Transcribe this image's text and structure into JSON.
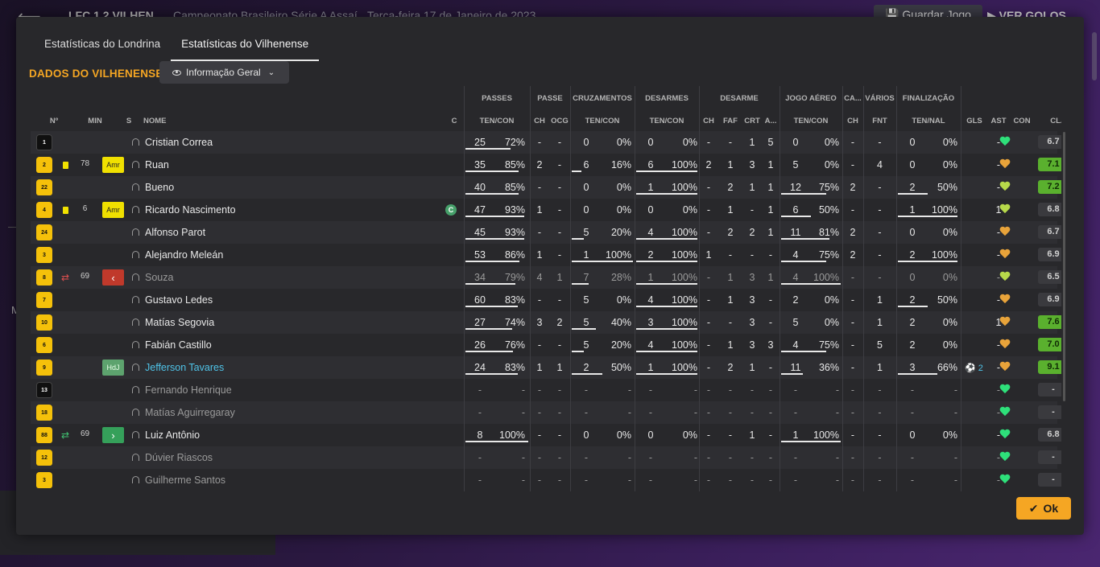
{
  "background": {
    "score": "LFC  1  2  VILHEN",
    "competition": "Campeonato Brasileiro Série A Assaí",
    "date": "Terça-feira 17 de Janeiro de 2023",
    "save_label": "Guardar Jogo",
    "goals_label": "VER GOLOS",
    "side_letter": "M"
  },
  "tabs": [
    {
      "label": "Estatísticas do Londrina"
    },
    {
      "label": "Estatísticas do Vilhenense"
    }
  ],
  "section_title": "DADOS DO VILHENENSE",
  "dropdown_label": "Informação Geral",
  "group_headers": [
    "PASSES",
    "PASSE",
    "CRUZAMENTOS",
    "DESARMES",
    "DESARME",
    "JOGO AÉREO",
    "CA...",
    "VÁRIOS",
    "FINALIZAÇÃO"
  ],
  "col_headers": [
    "Nº",
    "MIN",
    "S",
    "NOME",
    "C",
    "TEN/CON",
    "CH",
    "OCG",
    "TEN/CON",
    "TEN/CON",
    "CH",
    "FAF",
    "CRT",
    "A...",
    "TEN/CON",
    "CH",
    "FNT",
    "TEN/NAL",
    "GLS",
    "AST",
    "CON",
    "CLA"
  ],
  "players": [
    {
      "num": "1",
      "kit": "b",
      "card": "",
      "swap": "",
      "min": "",
      "badge": "",
      "badge_text": "",
      "name": "Cristian Correa",
      "cap": "",
      "dim": false,
      "link": false,
      "passes": [
        "25",
        "72%"
      ],
      "passes_pct": 72,
      "pch": "-",
      "ocg": "-",
      "cross": [
        "0",
        "0%"
      ],
      "cross_pct": 0,
      "tack": [
        "0",
        "0%"
      ],
      "tack_pct": 0,
      "dch": "-",
      "faf": "-",
      "crt": "1",
      "a": "5",
      "aer": [
        "0",
        "0%"
      ],
      "aer_pct": 0,
      "cach": "-",
      "fnt": "-",
      "fin": [
        "0",
        "0%"
      ],
      "fin_pct": 0,
      "gls": "",
      "ast": "-",
      "heart": "green",
      "rating": "6.7",
      "rating_good": false
    },
    {
      "num": "2",
      "kit": "y",
      "card": "yellow",
      "swap": "",
      "min": "78",
      "badge": "amr",
      "badge_text": "Amr",
      "name": "Ruan",
      "cap": "",
      "dim": false,
      "link": false,
      "passes": [
        "35",
        "85%"
      ],
      "passes_pct": 85,
      "pch": "2",
      "ocg": "-",
      "cross": [
        "6",
        "16%"
      ],
      "cross_pct": 16,
      "tack": [
        "6",
        "100%"
      ],
      "tack_pct": 100,
      "dch": "2",
      "faf": "1",
      "crt": "3",
      "a": "1",
      "aer": [
        "5",
        "0%"
      ],
      "aer_pct": 0,
      "cach": "-",
      "fnt": "4",
      "fin": [
        "0",
        "0%"
      ],
      "fin_pct": 0,
      "gls": "",
      "ast": "-",
      "heart": "orange",
      "rating": "7.1",
      "rating_good": true
    },
    {
      "num": "22",
      "kit": "y",
      "card": "",
      "swap": "",
      "min": "",
      "badge": "",
      "badge_text": "",
      "name": "Bueno",
      "cap": "",
      "dim": false,
      "link": false,
      "passes": [
        "40",
        "85%"
      ],
      "passes_pct": 85,
      "pch": "-",
      "ocg": "-",
      "cross": [
        "0",
        "0%"
      ],
      "cross_pct": 0,
      "tack": [
        "1",
        "100%"
      ],
      "tack_pct": 100,
      "dch": "-",
      "faf": "2",
      "crt": "1",
      "a": "1",
      "aer": [
        "12",
        "75%"
      ],
      "aer_pct": 75,
      "cach": "2",
      "fnt": "-",
      "fin": [
        "2",
        "50%"
      ],
      "fin_pct": 50,
      "gls": "",
      "ast": "-",
      "heart": "lime",
      "rating": "7.2",
      "rating_good": true
    },
    {
      "num": "4",
      "kit": "y",
      "card": "yellow",
      "swap": "",
      "min": "6",
      "badge": "amr",
      "badge_text": "Amr",
      "name": "Ricardo Nascimento",
      "cap": "C",
      "dim": false,
      "link": false,
      "passes": [
        "47",
        "93%"
      ],
      "passes_pct": 93,
      "pch": "1",
      "ocg": "-",
      "cross": [
        "0",
        "0%"
      ],
      "cross_pct": 0,
      "tack": [
        "0",
        "0%"
      ],
      "tack_pct": 0,
      "dch": "-",
      "faf": "1",
      "crt": "-",
      "a": "1",
      "aer": [
        "6",
        "50%"
      ],
      "aer_pct": 50,
      "cach": "-",
      "fnt": "-",
      "fin": [
        "1",
        "100%"
      ],
      "fin_pct": 100,
      "gls": "",
      "ast": "1",
      "heart": "lime",
      "rating": "6.8",
      "rating_good": false
    },
    {
      "num": "24",
      "kit": "y",
      "card": "",
      "swap": "",
      "min": "",
      "badge": "",
      "badge_text": "",
      "name": "Alfonso Parot",
      "cap": "",
      "dim": false,
      "link": false,
      "passes": [
        "45",
        "93%"
      ],
      "passes_pct": 93,
      "pch": "-",
      "ocg": "-",
      "cross": [
        "5",
        "20%"
      ],
      "cross_pct": 20,
      "tack": [
        "4",
        "100%"
      ],
      "tack_pct": 100,
      "dch": "-",
      "faf": "2",
      "crt": "2",
      "a": "1",
      "aer": [
        "11",
        "81%"
      ],
      "aer_pct": 81,
      "cach": "2",
      "fnt": "-",
      "fin": [
        "0",
        "0%"
      ],
      "fin_pct": 0,
      "gls": "",
      "ast": "-",
      "heart": "orange",
      "rating": "6.7",
      "rating_good": false
    },
    {
      "num": "3",
      "kit": "y",
      "card": "",
      "swap": "",
      "min": "",
      "badge": "",
      "badge_text": "",
      "name": "Alejandro Meleán",
      "cap": "",
      "dim": false,
      "link": false,
      "passes": [
        "53",
        "86%"
      ],
      "passes_pct": 86,
      "pch": "1",
      "ocg": "-",
      "cross": [
        "1",
        "100%"
      ],
      "cross_pct": 100,
      "tack": [
        "2",
        "100%"
      ],
      "tack_pct": 100,
      "dch": "1",
      "faf": "-",
      "crt": "-",
      "a": "-",
      "aer": [
        "4",
        "75%"
      ],
      "aer_pct": 75,
      "cach": "2",
      "fnt": "-",
      "fin": [
        "2",
        "100%"
      ],
      "fin_pct": 100,
      "gls": "",
      "ast": "-",
      "heart": "orange",
      "rating": "6.9",
      "rating_good": false
    },
    {
      "num": "8",
      "kit": "y",
      "card": "",
      "swap": "out",
      "min": "69",
      "badge": "out",
      "badge_text": "‹",
      "name": "Souza",
      "cap": "",
      "dim": true,
      "link": false,
      "passes": [
        "34",
        "79%"
      ],
      "passes_pct": 79,
      "pch": "4",
      "ocg": "1",
      "cross": [
        "7",
        "28%"
      ],
      "cross_pct": 28,
      "tack": [
        "1",
        "100%"
      ],
      "tack_pct": 100,
      "dch": "-",
      "faf": "1",
      "crt": "3",
      "a": "1",
      "aer": [
        "4",
        "100%"
      ],
      "aer_pct": 100,
      "cach": "-",
      "fnt": "-",
      "fin": [
        "0",
        "0%"
      ],
      "fin_pct": 0,
      "gls": "",
      "ast": "-",
      "heart": "lime",
      "rating": "6.5",
      "rating_good": false
    },
    {
      "num": "7",
      "kit": "y",
      "card": "",
      "swap": "",
      "min": "",
      "badge": "",
      "badge_text": "",
      "name": "Gustavo Ledes",
      "cap": "",
      "dim": false,
      "link": false,
      "passes": [
        "60",
        "83%"
      ],
      "passes_pct": 83,
      "pch": "-",
      "ocg": "-",
      "cross": [
        "5",
        "0%"
      ],
      "cross_pct": 0,
      "tack": [
        "4",
        "100%"
      ],
      "tack_pct": 100,
      "dch": "-",
      "faf": "1",
      "crt": "3",
      "a": "-",
      "aer": [
        "2",
        "0%"
      ],
      "aer_pct": 0,
      "cach": "-",
      "fnt": "1",
      "fin": [
        "2",
        "50%"
      ],
      "fin_pct": 50,
      "gls": "",
      "ast": "-",
      "heart": "orange",
      "rating": "6.9",
      "rating_good": false
    },
    {
      "num": "10",
      "kit": "y",
      "card": "",
      "swap": "",
      "min": "",
      "badge": "",
      "badge_text": "",
      "name": "Matías Segovia",
      "cap": "",
      "dim": false,
      "link": false,
      "passes": [
        "27",
        "74%"
      ],
      "passes_pct": 74,
      "pch": "3",
      "ocg": "2",
      "cross": [
        "5",
        "40%"
      ],
      "cross_pct": 40,
      "tack": [
        "3",
        "100%"
      ],
      "tack_pct": 100,
      "dch": "-",
      "faf": "-",
      "crt": "3",
      "a": "-",
      "aer": [
        "5",
        "0%"
      ],
      "aer_pct": 0,
      "cach": "-",
      "fnt": "1",
      "fin": [
        "2",
        "0%"
      ],
      "fin_pct": 0,
      "gls": "",
      "ast": "1",
      "heart": "orange",
      "rating": "7.6",
      "rating_good": true
    },
    {
      "num": "6",
      "kit": "y",
      "card": "",
      "swap": "",
      "min": "",
      "badge": "",
      "badge_text": "",
      "name": "Fabián Castillo",
      "cap": "",
      "dim": false,
      "link": false,
      "passes": [
        "26",
        "76%"
      ],
      "passes_pct": 76,
      "pch": "-",
      "ocg": "-",
      "cross": [
        "5",
        "20%"
      ],
      "cross_pct": 20,
      "tack": [
        "4",
        "100%"
      ],
      "tack_pct": 100,
      "dch": "-",
      "faf": "1",
      "crt": "3",
      "a": "3",
      "aer": [
        "4",
        "75%"
      ],
      "aer_pct": 75,
      "cach": "-",
      "fnt": "5",
      "fin": [
        "2",
        "0%"
      ],
      "fin_pct": 0,
      "gls": "",
      "ast": "-",
      "heart": "orange",
      "rating": "7.0",
      "rating_good": true
    },
    {
      "num": "9",
      "kit": "y",
      "card": "",
      "swap": "",
      "min": "",
      "badge": "hdj",
      "badge_text": "HdJ",
      "name": "Jefferson Tavares",
      "cap": "",
      "dim": false,
      "link": true,
      "passes": [
        "24",
        "83%"
      ],
      "passes_pct": 83,
      "pch": "1",
      "ocg": "1",
      "cross": [
        "2",
        "50%"
      ],
      "cross_pct": 50,
      "tack": [
        "1",
        "100%"
      ],
      "tack_pct": 100,
      "dch": "-",
      "faf": "2",
      "crt": "1",
      "a": "-",
      "aer": [
        "11",
        "36%"
      ],
      "aer_pct": 36,
      "cach": "-",
      "fnt": "1",
      "fin": [
        "3",
        "66%"
      ],
      "fin_pct": 66,
      "gls": "2",
      "ast": "-",
      "heart": "orange",
      "rating": "9.1",
      "rating_good": true
    },
    {
      "num": "13",
      "kit": "b",
      "card": "",
      "swap": "",
      "min": "",
      "badge": "",
      "badge_text": "",
      "name": "Fernando Henrique",
      "cap": "",
      "dim": true,
      "link": false,
      "passes": [
        "-",
        "-"
      ],
      "passes_pct": 0,
      "pch": "-",
      "ocg": "-",
      "cross": [
        "-",
        "-"
      ],
      "cross_pct": 0,
      "tack": [
        "-",
        "-"
      ],
      "tack_pct": 0,
      "dch": "-",
      "faf": "-",
      "crt": "-",
      "a": "-",
      "aer": [
        "-",
        "-"
      ],
      "aer_pct": 0,
      "cach": "-",
      "fnt": "-",
      "fin": [
        "-",
        "-"
      ],
      "fin_pct": 0,
      "gls": "",
      "ast": "-",
      "heart": "green",
      "rating": "-",
      "rating_good": false
    },
    {
      "num": "18",
      "kit": "y",
      "card": "",
      "swap": "",
      "min": "",
      "badge": "",
      "badge_text": "",
      "name": "Matías Aguirregaray",
      "cap": "",
      "dim": true,
      "link": false,
      "passes": [
        "-",
        "-"
      ],
      "passes_pct": 0,
      "pch": "-",
      "ocg": "-",
      "cross": [
        "-",
        "-"
      ],
      "cross_pct": 0,
      "tack": [
        "-",
        "-"
      ],
      "tack_pct": 0,
      "dch": "-",
      "faf": "-",
      "crt": "-",
      "a": "-",
      "aer": [
        "-",
        "-"
      ],
      "aer_pct": 0,
      "cach": "-",
      "fnt": "-",
      "fin": [
        "-",
        "-"
      ],
      "fin_pct": 0,
      "gls": "",
      "ast": "-",
      "heart": "green",
      "rating": "-",
      "rating_good": false
    },
    {
      "num": "88",
      "kit": "y",
      "card": "",
      "swap": "in",
      "min": "69",
      "badge": "in",
      "badge_text": "›",
      "name": "Luiz Antônio",
      "cap": "",
      "dim": false,
      "link": false,
      "passes": [
        "8",
        "100%"
      ],
      "passes_pct": 100,
      "pch": "-",
      "ocg": "-",
      "cross": [
        "0",
        "0%"
      ],
      "cross_pct": 0,
      "tack": [
        "0",
        "0%"
      ],
      "tack_pct": 0,
      "dch": "-",
      "faf": "-",
      "crt": "1",
      "a": "-",
      "aer": [
        "1",
        "100%"
      ],
      "aer_pct": 100,
      "cach": "-",
      "fnt": "-",
      "fin": [
        "0",
        "0%"
      ],
      "fin_pct": 0,
      "gls": "",
      "ast": "-",
      "heart": "green",
      "rating": "6.8",
      "rating_good": false
    },
    {
      "num": "12",
      "kit": "y",
      "card": "",
      "swap": "",
      "min": "",
      "badge": "",
      "badge_text": "",
      "name": "Dúvier Riascos",
      "cap": "",
      "dim": true,
      "link": false,
      "passes": [
        "-",
        "-"
      ],
      "passes_pct": 0,
      "pch": "-",
      "ocg": "-",
      "cross": [
        "-",
        "-"
      ],
      "cross_pct": 0,
      "tack": [
        "-",
        "-"
      ],
      "tack_pct": 0,
      "dch": "-",
      "faf": "-",
      "crt": "-",
      "a": "-",
      "aer": [
        "-",
        "-"
      ],
      "aer_pct": 0,
      "cach": "-",
      "fnt": "-",
      "fin": [
        "-",
        "-"
      ],
      "fin_pct": 0,
      "gls": "",
      "ast": "-",
      "heart": "green",
      "rating": "-",
      "rating_good": false
    },
    {
      "num": "3",
      "kit": "y",
      "card": "",
      "swap": "",
      "min": "",
      "badge": "",
      "badge_text": "",
      "name": "Guilherme Santos",
      "cap": "",
      "dim": true,
      "link": false,
      "passes": [
        "-",
        "-"
      ],
      "passes_pct": 0,
      "pch": "-",
      "ocg": "-",
      "cross": [
        "-",
        "-"
      ],
      "cross_pct": 0,
      "tack": [
        "-",
        "-"
      ],
      "tack_pct": 0,
      "dch": "-",
      "faf": "-",
      "crt": "-",
      "a": "-",
      "aer": [
        "-",
        "-"
      ],
      "aer_pct": 0,
      "cach": "-",
      "fnt": "-",
      "fin": [
        "-",
        "-"
      ],
      "fin_pct": 0,
      "gls": "",
      "ast": "-",
      "heart": "green",
      "rating": "-",
      "rating_good": false
    }
  ],
  "ok_label": "Ok"
}
